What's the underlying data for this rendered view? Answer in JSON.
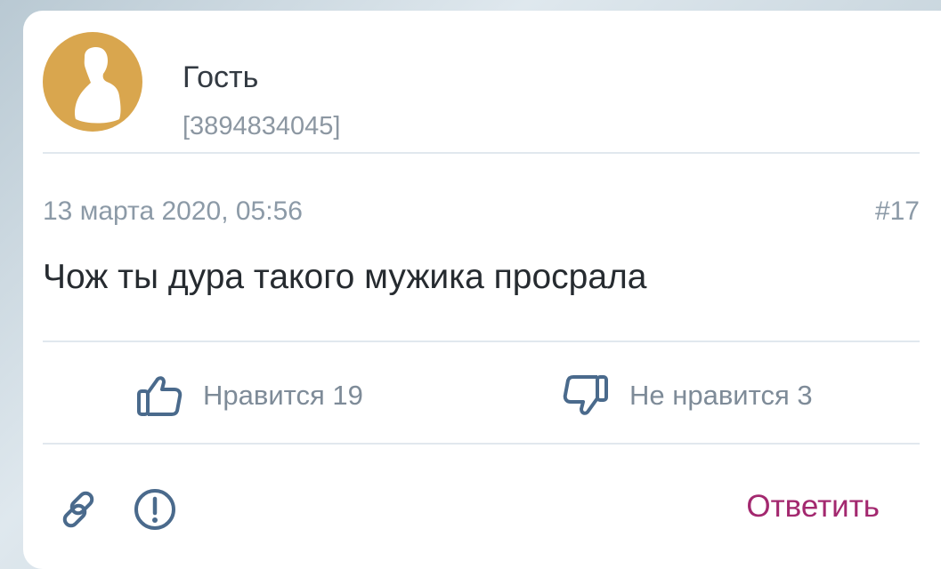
{
  "author": {
    "name": "Гость",
    "id": "[3894834045]",
    "avatar_icon": "user-silhouette-icon",
    "avatar_color": "#d9a64e"
  },
  "meta": {
    "date": "13 марта 2020, 05:56",
    "number": "#17"
  },
  "comment": {
    "text": "Чож ты дура такого мужика просрала"
  },
  "votes": {
    "like_label": "Нравится 19",
    "like_icon": "thumbs-up-icon",
    "dislike_label": "Не нравится 3",
    "dislike_icon": "thumbs-down-icon"
  },
  "footer": {
    "link_icon": "link-icon",
    "report_icon": "exclamation-circle-icon",
    "reply_label": "Ответить",
    "reply_color": "#a3286f"
  }
}
